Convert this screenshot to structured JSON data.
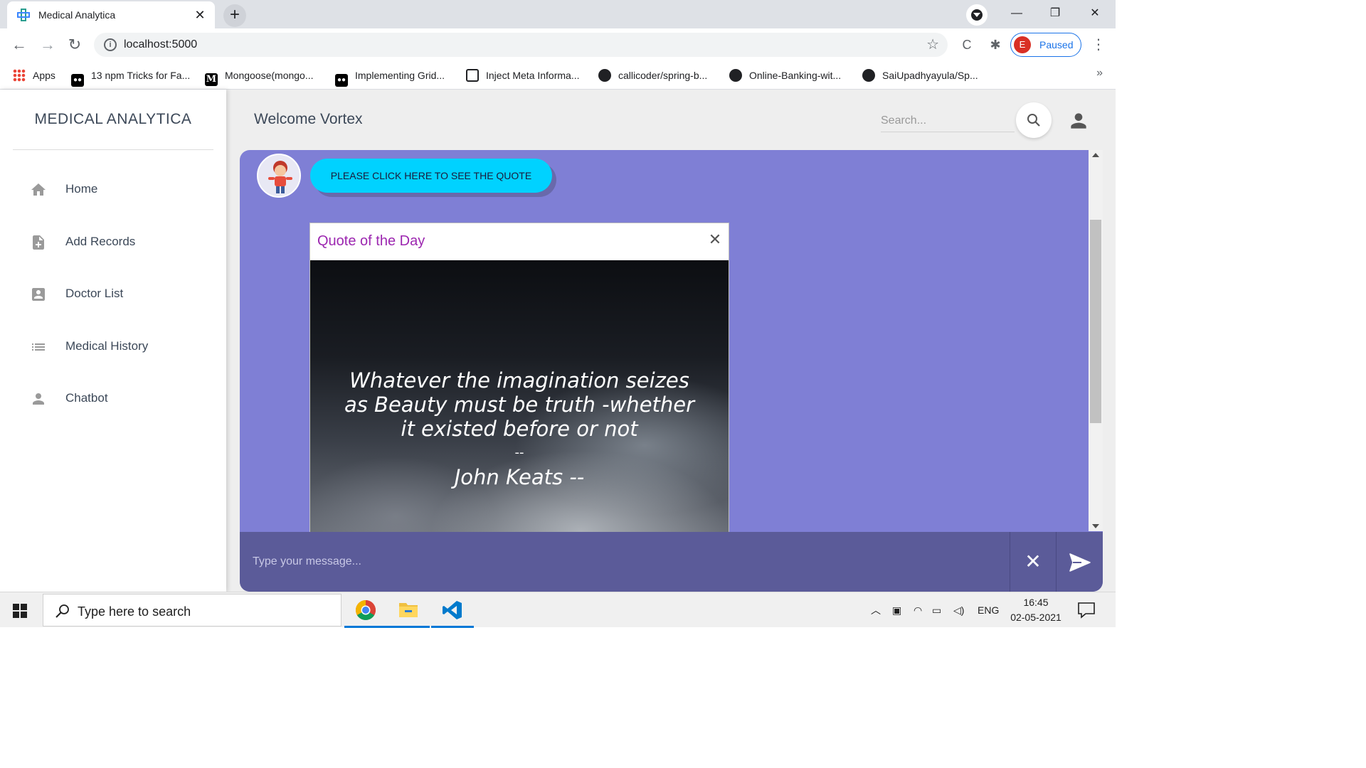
{
  "browser": {
    "tab_title": "Medical Analytica",
    "url": "localhost:5000",
    "profile_initial": "E",
    "profile_status": "Paused",
    "bookmarks": [
      {
        "label": "Apps",
        "icon": "apps-grid-icon"
      },
      {
        "label": "13 npm Tricks for Fa...",
        "icon": "medium-icon"
      },
      {
        "label": "Mongoose(mongo...",
        "icon": "medium-m-icon"
      },
      {
        "label": "Implementing Grid...",
        "icon": "medium-icon"
      },
      {
        "label": "Inject Meta Informa...",
        "icon": "document-icon"
      },
      {
        "label": "callicoder/spring-b...",
        "icon": "github-icon"
      },
      {
        "label": "Online-Banking-wit...",
        "icon": "github-icon"
      },
      {
        "label": "SaiUpadhyayula/Sp...",
        "icon": "github-icon"
      }
    ]
  },
  "app": {
    "brand": "MEDICAL ANALYTICA",
    "welcome": "Welcome Vortex",
    "search_placeholder": "Search...",
    "nav": [
      {
        "label": "Home",
        "icon": "home-icon"
      },
      {
        "label": "Add Records",
        "icon": "add-document-icon"
      },
      {
        "label": "Doctor List",
        "icon": "contact-card-icon"
      },
      {
        "label": "Medical History",
        "icon": "list-icon"
      },
      {
        "label": "Chatbot",
        "icon": "person-icon"
      }
    ],
    "chat": {
      "quote_button": "PLEASE CLICK HERE TO SEE THE QUOTE",
      "modal_title": "Quote of the Day",
      "quote_lines": [
        "Whatever the imagination seizes",
        "as Beauty must be truth -whether",
        "it existed before or not"
      ],
      "quote_dash": "--",
      "quote_author": "John Keats  --",
      "message_placeholder": "Type your message..."
    },
    "colors": {
      "chat_bg": "#7f7fd5",
      "footer_bg": "#5b5b99",
      "quote_button": "#00d2ff",
      "modal_title": "#9c27b0"
    }
  },
  "taskbar": {
    "search_placeholder": "Type here to search",
    "language": "ENG",
    "time": "16:45",
    "date": "02-05-2021"
  }
}
